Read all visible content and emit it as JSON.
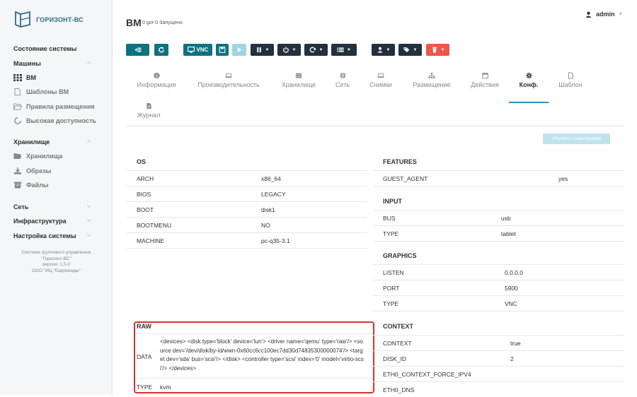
{
  "brand": {
    "name": "ГОРИЗОНТ-ВС"
  },
  "sidebar": {
    "system_status": "Состояние системы",
    "machines": "Машины",
    "items_machines": [
      "ВМ",
      "Шаблоны ВМ",
      "Правила размещения",
      "Высокая доступность"
    ],
    "storage": "Хранилище",
    "items_storage": [
      "Хранилища",
      "Образы",
      "Файлы"
    ],
    "network": "Сеть",
    "infrastructure": "Инфраструктура",
    "settings": "Настройка системы",
    "footer": [
      "Система группового управления",
      "\"Горизонт-ВС\"",
      "версия: 1.5.0",
      "ООО \"ИЦ \"Баррикады\""
    ]
  },
  "header": {
    "title": "ВМ",
    "subtitle": "0 gor-0 Запущено",
    "user": "admin"
  },
  "toolbar": {
    "vnc": "VNC"
  },
  "tabs": [
    "Информация",
    "Производительность",
    "Хранилище",
    "Сеть",
    "Снимки",
    "Размещение",
    "Действия",
    "Конф.",
    "Шаблон",
    "Журнал"
  ],
  "update_button": "Обновить конфигурацию",
  "os": {
    "title": "OS",
    "rows": [
      {
        "k": "ARCH",
        "v": "x86_64"
      },
      {
        "k": "BIOS",
        "v": "LEGACY"
      },
      {
        "k": "BOOT",
        "v": "disk1"
      },
      {
        "k": "BOOTMENU",
        "v": "NO"
      },
      {
        "k": "MACHINE",
        "v": "pc-q35-3.1"
      }
    ]
  },
  "features": {
    "title": "FEATURES",
    "rows": [
      {
        "k": "GUEST_AGENT",
        "v": "yes"
      }
    ]
  },
  "input": {
    "title": "INPUT",
    "rows": [
      {
        "k": "BUS",
        "v": "usb"
      },
      {
        "k": "TYPE",
        "v": "tablet"
      }
    ]
  },
  "graphics": {
    "title": "GRAPHICS",
    "rows": [
      {
        "k": "LISTEN",
        "v": "0.0.0.0"
      },
      {
        "k": "PORT",
        "v": "5900"
      },
      {
        "k": "TYPE",
        "v": "VNC"
      }
    ]
  },
  "raw": {
    "title": "RAW",
    "data_key": "DATA",
    "data_value": "<devices> <disk type='block' device='lun'> <driver name='qemu' type='raw'/> <source dev='/dev/disk/by-id/wwn-0x60cc6cc100ec7dd30d74835300000074'/> <target dev='sda' bus='scsi'/> </disk> <controller type='scsi' index='0' model='virtio-scsi'/> </devices>",
    "type_key": "TYPE",
    "type_value": "kvm"
  },
  "context": {
    "title": "CONTEXT",
    "rows": [
      {
        "k": "CONTEXT",
        "v": "true"
      },
      {
        "k": "DISK_ID",
        "v": "2"
      },
      {
        "k": "ETH0_CONTEXT_FORCE_IPV4",
        "v": ""
      },
      {
        "k": "ETH0_DNS",
        "v": ""
      }
    ]
  }
}
